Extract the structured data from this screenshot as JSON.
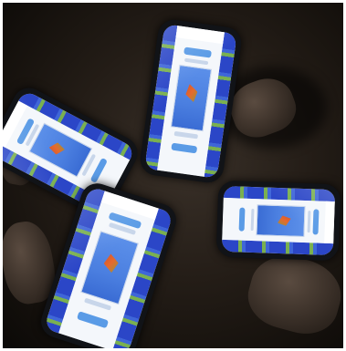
{
  "scene": {
    "description_colors": {
      "background": "#1a1511",
      "screen_card": "#f4f7fb",
      "accent_blue": "#5a9be6",
      "pattern_blue": "#2b46c7",
      "pattern_green": "#7ab050",
      "kite_orange": "#e56a2e"
    }
  }
}
